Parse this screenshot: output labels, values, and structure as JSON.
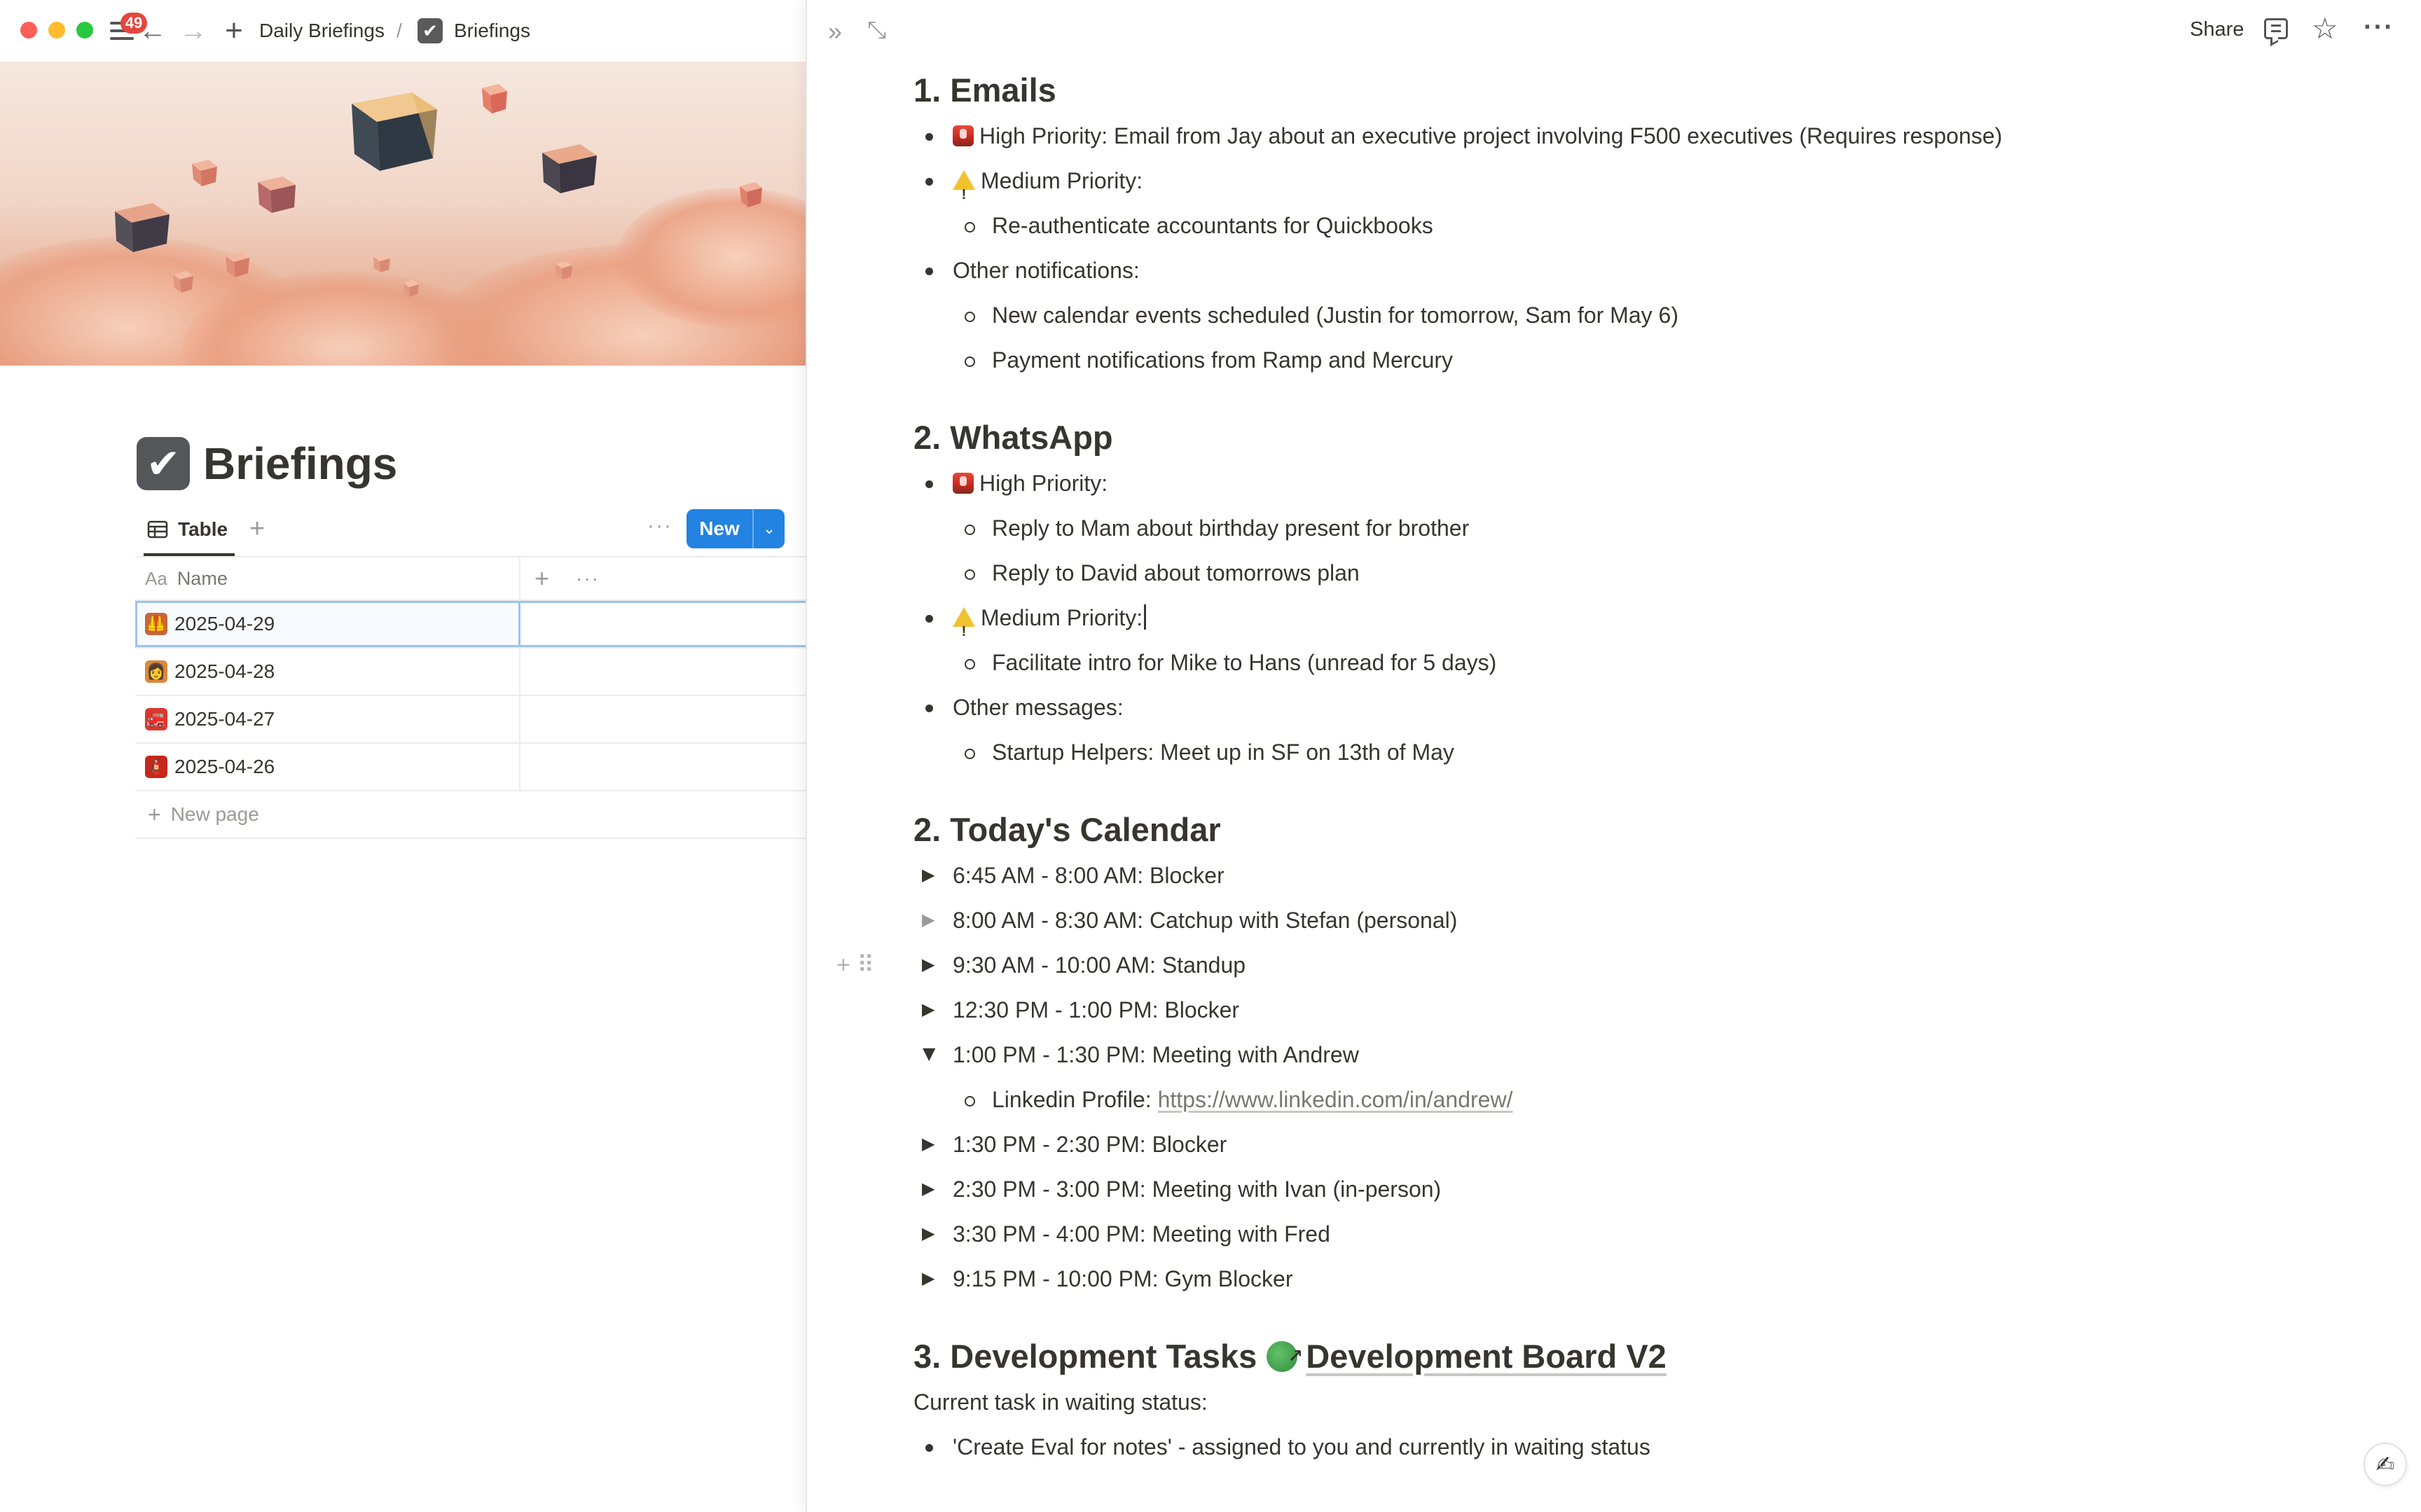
{
  "window": {
    "notification_count": "49"
  },
  "breadcrumb": {
    "parent": "Daily Briefings",
    "separator": "/",
    "current": "Briefings"
  },
  "database": {
    "title": "Briefings",
    "view_label": "Table",
    "new_button_label": "New",
    "name_column": "Name",
    "name_column_prefix": "Aa",
    "rows": [
      {
        "name": "2025-04-29",
        "emoji": "vest-icon",
        "color": "#c9663a"
      },
      {
        "name": "2025-04-28",
        "emoji": "firefighter-icon",
        "color": "#d9893b"
      },
      {
        "name": "2025-04-27",
        "emoji": "fire-truck-icon",
        "color": "#d8392b"
      },
      {
        "name": "2025-04-26",
        "emoji": "fire-extinguisher-icon",
        "color": "#c7281c"
      }
    ],
    "new_page_label": "New page"
  },
  "peek_header": {
    "share_label": "Share"
  },
  "doc": {
    "emails": {
      "heading": "1. Emails",
      "high_priority": "High Priority: Email from Jay about an executive project involving F500 executives (Requires response)",
      "medium_priority": "Medium Priority:",
      "medium_items": [
        "Re-authenticate accountants for Quickbooks"
      ],
      "other_label": "Other notifications:",
      "other_items": [
        "New calendar events scheduled (Justin for tomorrow, Sam for May 6)",
        "Payment notifications from Ramp and Mercury"
      ]
    },
    "whatsapp": {
      "heading": "2. WhatsApp",
      "high_priority": "High Priority:",
      "high_items": [
        "Reply to Mam about birthday present for brother",
        "Reply to David about tomorrows plan"
      ],
      "medium_priority": "Medium Priority:",
      "medium_items": [
        "Facilitate intro for Mike to Hans (unread for 5 days)"
      ],
      "other_label": "Other messages:",
      "other_items": [
        "Startup Helpers: Meet up in SF on 13th of May"
      ]
    },
    "calendar": {
      "heading": "2. Today's Calendar",
      "events": [
        "6:45 AM - 8:00 AM: Blocker",
        "8:00 AM - 8:30 AM: Catchup with Stefan (personal)",
        "9:30 AM - 10:00 AM: Standup",
        "12:30 PM - 1:00 PM: Blocker",
        "1:00 PM - 1:30 PM: Meeting with Andrew",
        "1:30 PM - 2:30 PM: Blocker",
        "2:30 PM - 3:00 PM: Meeting with Ivan (in-person)",
        "3:30 PM - 4:00 PM: Meeting with Fred",
        "9:15 PM - 10:00 PM: Gym Blocker"
      ],
      "andrew_detail_label": "Linkedin Profile:",
      "andrew_detail_url": "https://www.linkedin.com/in/andrew/"
    },
    "dev": {
      "heading": "3. Development Tasks",
      "board_link": "Development Board V2",
      "intro": "Current task in waiting status:",
      "items": [
        "'Create Eval for notes' - assigned to you and currently in waiting status"
      ]
    }
  }
}
